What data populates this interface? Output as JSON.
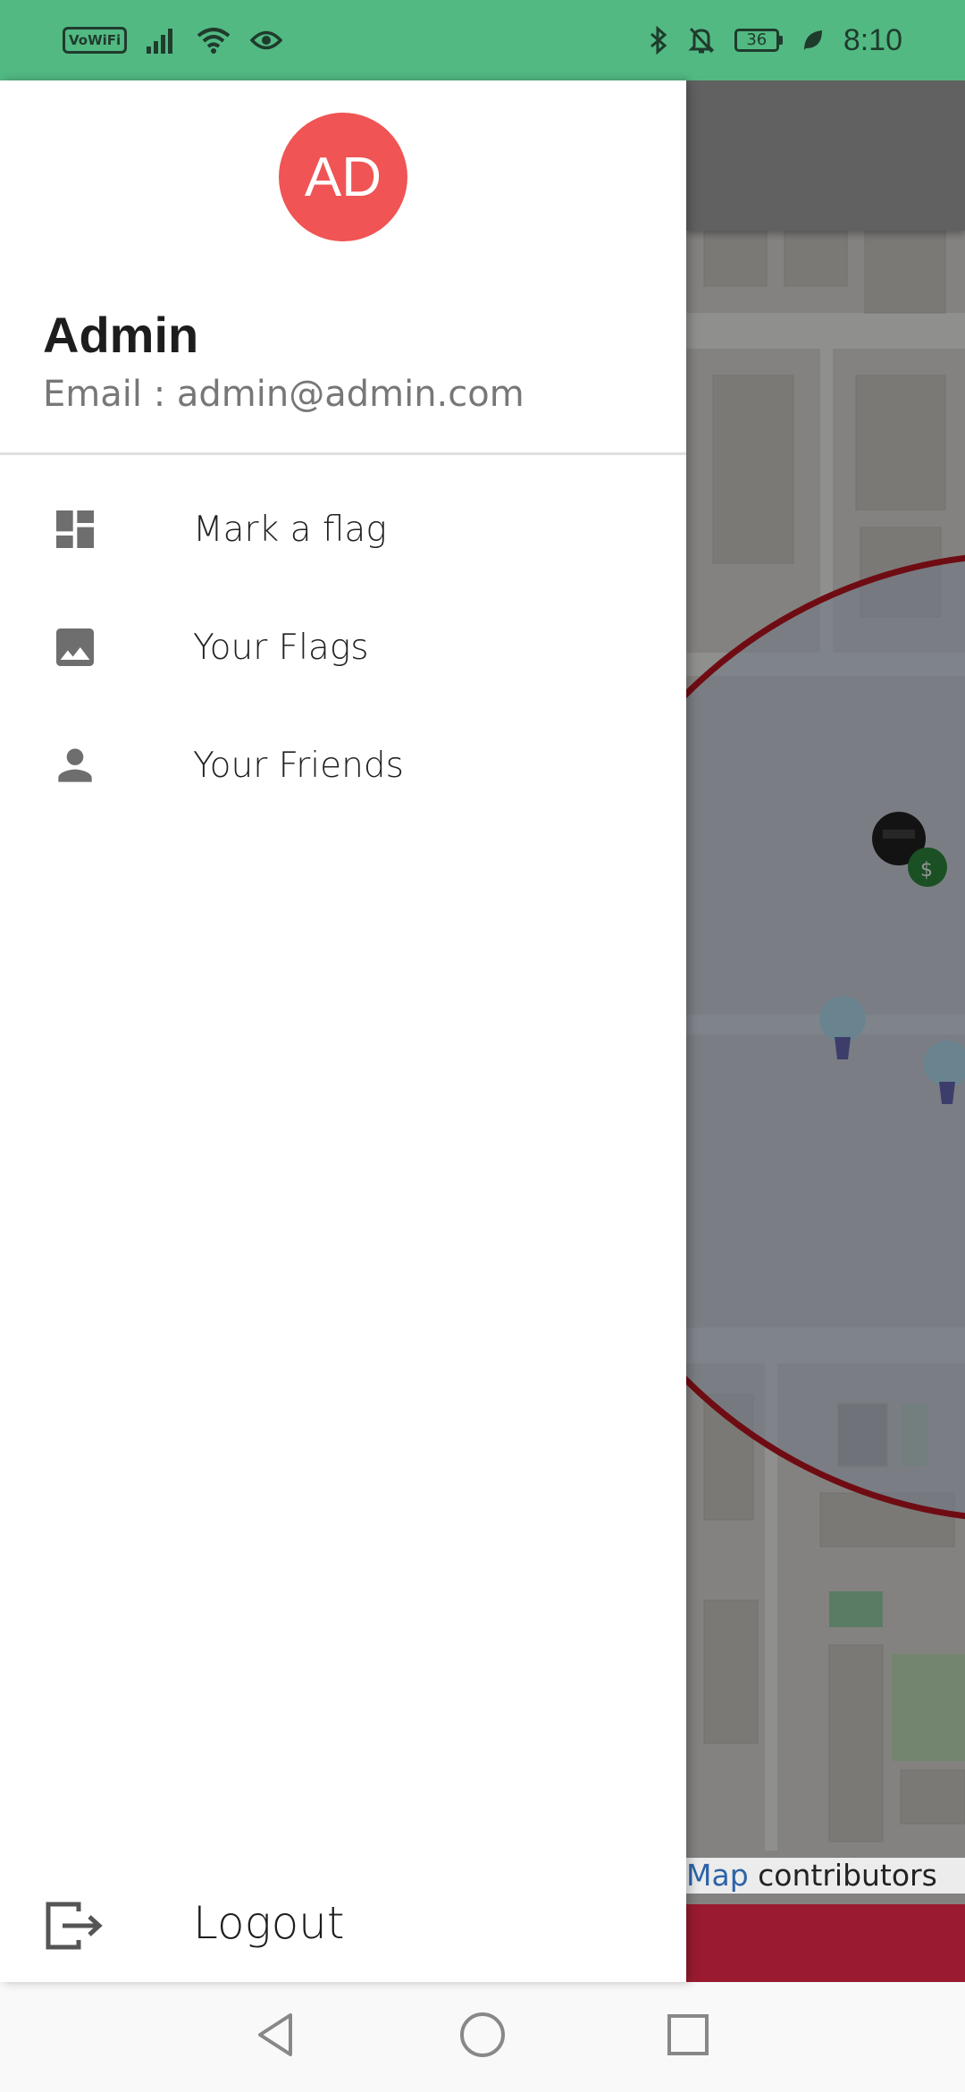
{
  "status_bar": {
    "vowifi": "VoWiFi",
    "battery": "36",
    "time": "8:10",
    "icons": [
      "vowifi-icon",
      "signal-icon",
      "wifi-icon",
      "eye-icon",
      "bluetooth-icon",
      "bell-off-icon",
      "battery-icon",
      "leaf-icon"
    ]
  },
  "drawer": {
    "avatar_initials": "AD",
    "avatar_color": "#f05454",
    "user_name": "Admin",
    "user_email": "Email : admin@admin.com",
    "menu": [
      {
        "label": "Mark a flag",
        "icon": "dashboard-icon"
      },
      {
        "label": "Your Flags",
        "icon": "image-icon"
      },
      {
        "label": "Your Friends",
        "icon": "person-icon"
      }
    ],
    "logout_label": "Logout"
  },
  "map": {
    "attribution_link": "Map",
    "attribution_text": " contributors",
    "accent_circle_color": "#c01622",
    "bottom_bar_color": "#9a1b31"
  },
  "nav_bar": {
    "buttons": [
      "back-icon",
      "home-icon",
      "recents-icon"
    ]
  }
}
